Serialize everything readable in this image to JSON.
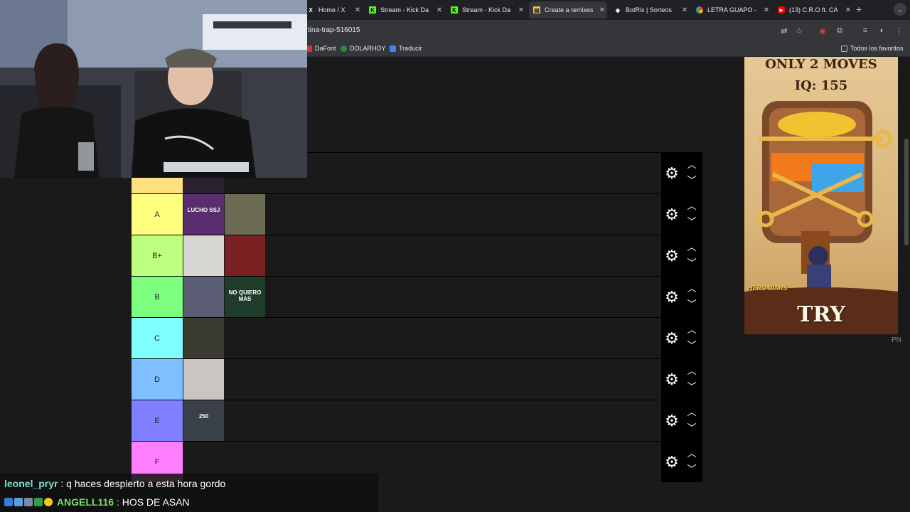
{
  "browser": {
    "tabs": [
      {
        "title": "Home / X",
        "favicon": "x-icon",
        "active": false
      },
      {
        "title": "Stream - Kick Da",
        "favicon": "kick-icon",
        "active": false
      },
      {
        "title": "Stream - Kick Da",
        "favicon": "kick-icon",
        "active": false
      },
      {
        "title": "Create a remixes",
        "favicon": "tiermaker-icon",
        "active": true
      },
      {
        "title": "BotRix | Sorteos",
        "favicon": "botrix-icon",
        "active": false
      },
      {
        "title": "LETRA GUAPO -",
        "favicon": "google-icon",
        "active": false
      },
      {
        "title": "(13) C.R.O ft. CA",
        "favicon": "youtube-icon",
        "active": false
      }
    ],
    "url": "tina-trap-516015",
    "bookmarks": [
      "DaFont",
      "DOLARHOY",
      "Traducir"
    ],
    "all_bookmarks": "Todos los favoritos"
  },
  "tiers": [
    {
      "label": "",
      "color": "#ffdf80",
      "covers": [
        {
          "text": "",
          "bg": "#2a2030"
        }
      ]
    },
    {
      "label": "A",
      "color": "#ffff7f",
      "covers": [
        {
          "text": "LUCHO SSJ",
          "bg": "#5a2d6e"
        },
        {
          "text": "",
          "bg": "#6b6a52"
        }
      ]
    },
    {
      "label": "B+",
      "color": "#bfff7f",
      "covers": [
        {
          "text": "",
          "bg": "#d8d6d2"
        },
        {
          "text": "",
          "bg": "#7a2020"
        }
      ]
    },
    {
      "label": "B",
      "color": "#7fff7f",
      "covers": [
        {
          "text": "",
          "bg": "#5b5d75"
        },
        {
          "text": "NO QUIERO MAS",
          "bg": "#1f3b2a"
        }
      ]
    },
    {
      "label": "C",
      "color": "#7fffff",
      "covers": [
        {
          "text": "",
          "bg": "#3a3a30"
        }
      ]
    },
    {
      "label": "D",
      "color": "#7fbfff",
      "covers": [
        {
          "text": "",
          "bg": "#c9c5c0"
        }
      ]
    },
    {
      "label": "E",
      "color": "#7f7fff",
      "covers": [
        {
          "text": "250",
          "bg": "#3a4048"
        }
      ]
    },
    {
      "label": "F",
      "color": "#ff7fff",
      "covers": []
    }
  ],
  "ad": {
    "headline": "ONLY 2 MOVES",
    "iq": "IQ: 155",
    "brand": "HERO WARS",
    "cta": "TRY"
  },
  "pn_label": "PN",
  "chat": [
    {
      "user": "leonel_pryr",
      "user_color": "#7ee0d0",
      "message": "q haces despierto a esta hora gordo"
    },
    {
      "user": "ANGELL116",
      "user_color": "#7edc6a",
      "message": "HOS DE ASAN"
    }
  ]
}
